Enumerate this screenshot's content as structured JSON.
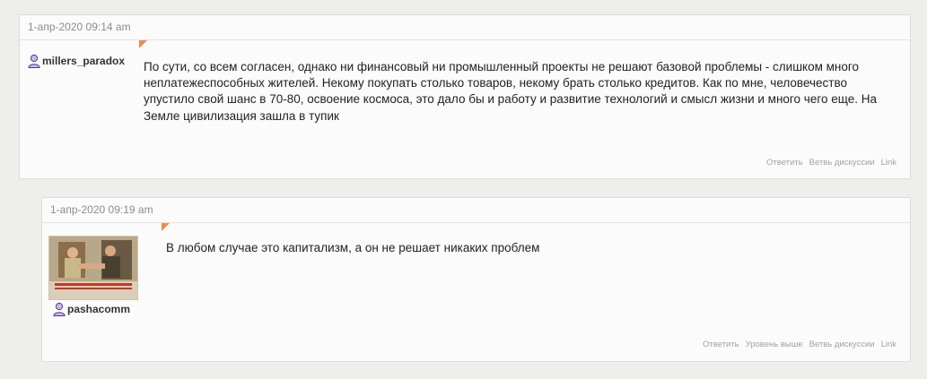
{
  "comments": [
    {
      "timestamp": "1-апр-2020 09:14 am",
      "username": "millers_paradox",
      "text": "По сути, со всем согласен, однако ни финансовый ни промышленный проекты не решают базовой проблемы - слишком много неплатежеспособных жителей. Некому покупать столько товаров, некому брать столько кредитов. Как по мне, человечество упустило свой шанс в 70-80, освоение космоса, это дало бы и работу и развитие технологий и смысл жизни и много чего еще. На Земле цивилизация зашла в тупик",
      "actions": [
        "Ответить",
        "Ветвь дискуссии",
        "Link"
      ]
    },
    {
      "timestamp": "1-апр-2020 09:19 am",
      "username": "pashacomm",
      "text": "В любом случае это капитализм, а он не решает никаких проблем",
      "actions": [
        "Ответить",
        "Уровень выше",
        "Ветвь дискуссии",
        "Link"
      ]
    }
  ],
  "icons": {
    "user": "user-icon",
    "accent_color": "#f08a49"
  }
}
